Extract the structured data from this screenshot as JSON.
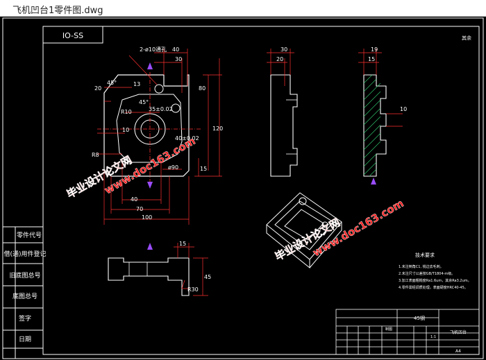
{
  "window": {
    "title": "飞机凹台1零件图.dwg"
  },
  "drawing": {
    "drawing_no_box": "IO-SS",
    "top_right_note": "其余",
    "dims": {
      "holes": "2-ø10通孔",
      "d40_top": "40",
      "d30_top": "30",
      "d20_left": "20",
      "d45_left": "45°",
      "d13": "13",
      "d80": "80",
      "r10": "R10",
      "d10": "10",
      "d45_mid": "45°",
      "d35": "35±0.02",
      "d40_mid": "40±0.02",
      "d120": "120",
      "r8": "R8",
      "d90": "ø90",
      "d15_right": "15",
      "d40_bottom": "40",
      "d70": "70",
      "d100": "100",
      "sv_d30": "30",
      "sv_d20": "20",
      "sv2_d19": "19",
      "sv2_d15": "15",
      "sv2_d10": "10",
      "bv_d15": "15",
      "bv_d45": "45",
      "bv_r30": "R30"
    },
    "left_labels": [
      "零件代号",
      "借(通)用件登记",
      "旧底图总号",
      "底图总号",
      "签字",
      "日期"
    ],
    "tech_notes": {
      "heading": "技术要求",
      "lines": [
        "1.未注倒角C1, 锐边去毛刺。",
        "2.未注尺寸公差按GB/T1804-m级。",
        "3.加工表面粗糙度Ra1.6um，其余Ra3.2um。",
        "4.零件需经调质处理，表面硬度HRC40-45。"
      ]
    },
    "title_block": {
      "material": "45钢",
      "part_name": "飞机凹台",
      "scale": "1:1",
      "sheet": "A4",
      "company": "制图"
    },
    "watermarks": [
      "毕业设计论文网",
      "www.doc163.com"
    ]
  }
}
